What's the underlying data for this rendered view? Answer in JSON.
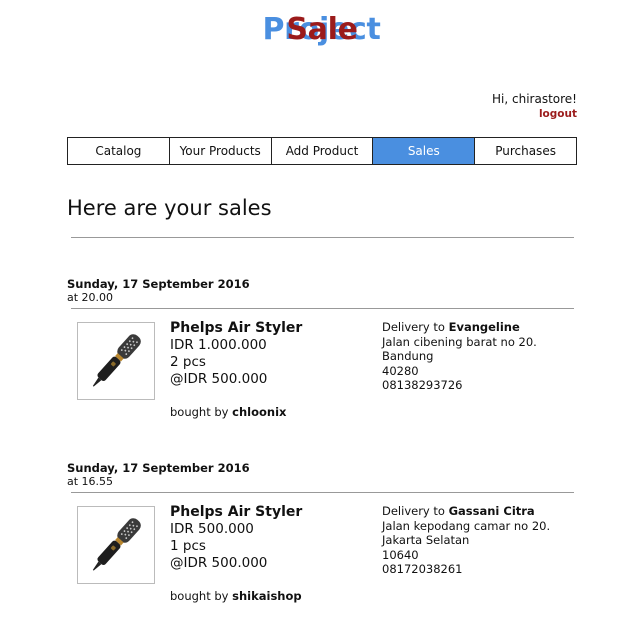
{
  "brand": {
    "part1": "Sale",
    "part2": "Project"
  },
  "user": {
    "greeting": "Hi, chirastore!",
    "logout": "logout"
  },
  "nav": {
    "tabs": [
      {
        "label": "Catalog",
        "active": false
      },
      {
        "label": "Your Products",
        "active": false
      },
      {
        "label": "Add Product",
        "active": false
      },
      {
        "label": "Sales",
        "active": true
      },
      {
        "label": "Purchases",
        "active": false
      }
    ]
  },
  "page": {
    "heading": "Here are your sales"
  },
  "colors": {
    "brand_red": "#9b1b1b",
    "brand_blue": "#4a8fe0"
  },
  "sales": [
    {
      "date": "Sunday, 17 September 2016",
      "time": "at 20.00",
      "product": {
        "name": "Phelps Air Styler",
        "total": "IDR 1.000.000",
        "qty": "2 pcs",
        "unit_price": "@IDR 500.000",
        "image_icon": "hair-styler-icon"
      },
      "buyer_prefix": "bought by",
      "buyer": "chloonix",
      "delivery": {
        "prefix": "Delivery to",
        "name": "Evangeline",
        "address": "Jalan cibening barat no 20.",
        "city": "Bandung",
        "postal": "40280",
        "phone": "08138293726"
      }
    },
    {
      "date": "Sunday, 17 September 2016",
      "time": "at 16.55",
      "product": {
        "name": "Phelps Air Styler",
        "total": "IDR 500.000",
        "qty": "1 pcs",
        "unit_price": "@IDR 500.000",
        "image_icon": "hair-styler-icon"
      },
      "buyer_prefix": "bought by",
      "buyer": "shikaishop",
      "delivery": {
        "prefix": "Delivery to",
        "name": "Gassani Citra",
        "address": "Jalan kepodang camar no 20.",
        "city": "Jakarta Selatan",
        "postal": "10640",
        "phone": "08172038261"
      }
    }
  ]
}
